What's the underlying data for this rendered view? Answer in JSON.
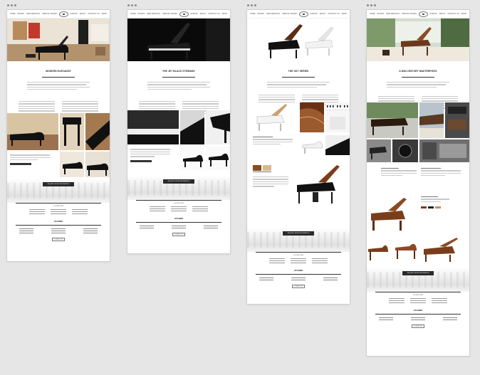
{
  "artboards": [
    {
      "title": "MODERN ELEGANCE",
      "cta": "REQUEST MORE INFORMATION",
      "sub": "LOCATIONS",
      "link": "SCHEDULE A VISIT",
      "btn": "CONTACT US"
    },
    {
      "title": "THE JET BLACK STEINWAY",
      "cta": "REQUEST MORE INFORMATION",
      "sub": "LOCATIONS",
      "link": "SCHEDULE A VISIT",
      "btn": "CONTACT US"
    },
    {
      "title": "THE SKY SERIES",
      "cta": "REQUEST MORE INFORMATION",
      "sub": "LOCATIONS",
      "link": "SCHEDULE A VISIT",
      "btn": "CONTACT US"
    },
    {
      "title": "A MID-CENTURY MASTERPIECE",
      "cta": "REQUEST MORE INFORMATION",
      "sub": "LOCATIONS",
      "link": "SCHEDULE A VISIT",
      "btn": "CONTACT US"
    }
  ],
  "nav": [
    "HOME",
    "PIANOS",
    "NEW ARRIVALS",
    "SPECIAL PIECES",
    "EVENTS",
    "ABOUT",
    "CONTACT US",
    "SHOWROOMS",
    "BLOG",
    "SHOP"
  ],
  "brand": "JACOBS",
  "colors": {
    "bg": "#e6e6e6",
    "page": "#ffffff",
    "ink": "#222222",
    "wood": "#7a3d1b"
  }
}
